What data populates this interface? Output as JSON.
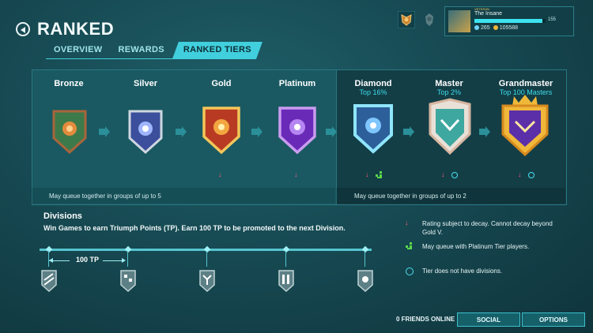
{
  "header": {
    "title": "RANKED",
    "tabs": [
      {
        "label": "OVERVIEW"
      },
      {
        "label": "REWARDS"
      },
      {
        "label": "RANKED TIERS"
      }
    ]
  },
  "profile": {
    "title_badge": "VETERAN",
    "name": "The Insane",
    "level": "155",
    "xp_fraction": 0.95,
    "gems": "265",
    "gold": "105588"
  },
  "tiers": [
    {
      "name": "Bronze",
      "sub": ""
    },
    {
      "name": "Silver",
      "sub": ""
    },
    {
      "name": "Gold",
      "sub": ""
    },
    {
      "name": "Platinum",
      "sub": ""
    },
    {
      "name": "Diamond",
      "sub": "Top 16%"
    },
    {
      "name": "Master",
      "sub": "Top 2%"
    },
    {
      "name": "Grandmaster",
      "sub": "Top 100 Masters"
    }
  ],
  "group_notes": {
    "left": "May queue together in groups of up to 5",
    "right": "May queue together in groups of up to 2"
  },
  "divisions": {
    "title": "Divisions",
    "description": "Win Games to earn Triumph Points (TP).  Earn 100 TP to be promoted to the next Division.",
    "tp_label": "100 TP"
  },
  "legend": {
    "decay": "Rating subject to decay. Cannot decay beyond Gold V.",
    "platinum": "May queue with Platinum Tier players.",
    "no_divisions": "Tier does not have divisions."
  },
  "footer": {
    "friends": "0 FRIENDS ONLINE",
    "social": "SOCIAL",
    "options": "OPTIONS"
  },
  "colors": {
    "accent": "#41cfdd",
    "decay": "#ff5c7a",
    "queue": "#59d84a"
  }
}
